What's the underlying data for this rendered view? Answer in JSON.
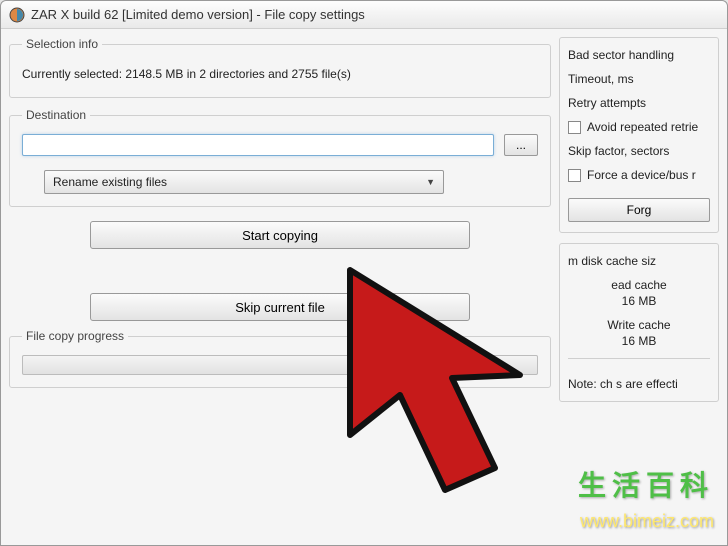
{
  "titlebar": {
    "title": "ZAR X build 62 [Limited demo version] - File copy settings"
  },
  "selection": {
    "legend": "Selection info",
    "text": "Currently selected: 2148.5 MB in 2 directories and 2755 file(s)"
  },
  "destination": {
    "legend": "Destination",
    "path_value": "",
    "placeholder": "",
    "browse_label": "...",
    "conflict_selected": "Rename existing files"
  },
  "actions": {
    "start_label": "Start copying",
    "skip_label": "Skip current file"
  },
  "progress": {
    "legend": "File copy progress"
  },
  "bad_sector": {
    "legend": "Bad sector handling",
    "timeout_label": "Timeout, ms",
    "retry_label": "Retry attempts",
    "avoid_label": "Avoid repeated retrie",
    "skip_label": "Skip factor, sectors",
    "force_label": "Force a device/bus r",
    "forget_label": "Forg"
  },
  "cache": {
    "max_label": "m disk cache siz",
    "read_label": "ead cache",
    "read_value": "16 MB",
    "write_label": "Write cache",
    "write_value": "16 MB"
  },
  "note": {
    "text": "Note: ch         s are effecti"
  },
  "watermark": {
    "text1": "生活百科",
    "text2": "www.bimeiz.com"
  }
}
